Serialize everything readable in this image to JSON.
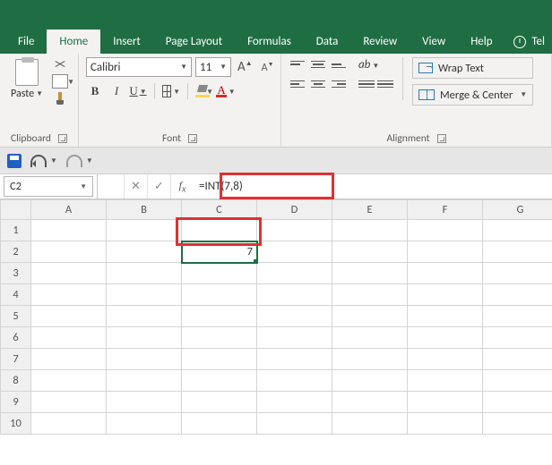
{
  "tabs": {
    "file": "File",
    "home": "Home",
    "insert": "Insert",
    "page_layout": "Page Layout",
    "formulas": "Formulas",
    "data": "Data",
    "review": "Review",
    "view": "View",
    "help": "Help",
    "tell_me": "Tel"
  },
  "clipboard": {
    "paste": "Paste",
    "label": "Clipboard"
  },
  "font": {
    "name": "Calibri",
    "size": "11",
    "label": "Font"
  },
  "alignment": {
    "wrap": "Wrap Text",
    "merge": "Merge & Center",
    "label": "Alignment"
  },
  "namebox": "C2",
  "formula": "=INT(7,8)",
  "columns": [
    "A",
    "B",
    "C",
    "D",
    "E",
    "F",
    "G"
  ],
  "rows": [
    "1",
    "2",
    "3",
    "4",
    "5",
    "6",
    "7",
    "8",
    "9",
    "10"
  ],
  "cell_c2": "7"
}
